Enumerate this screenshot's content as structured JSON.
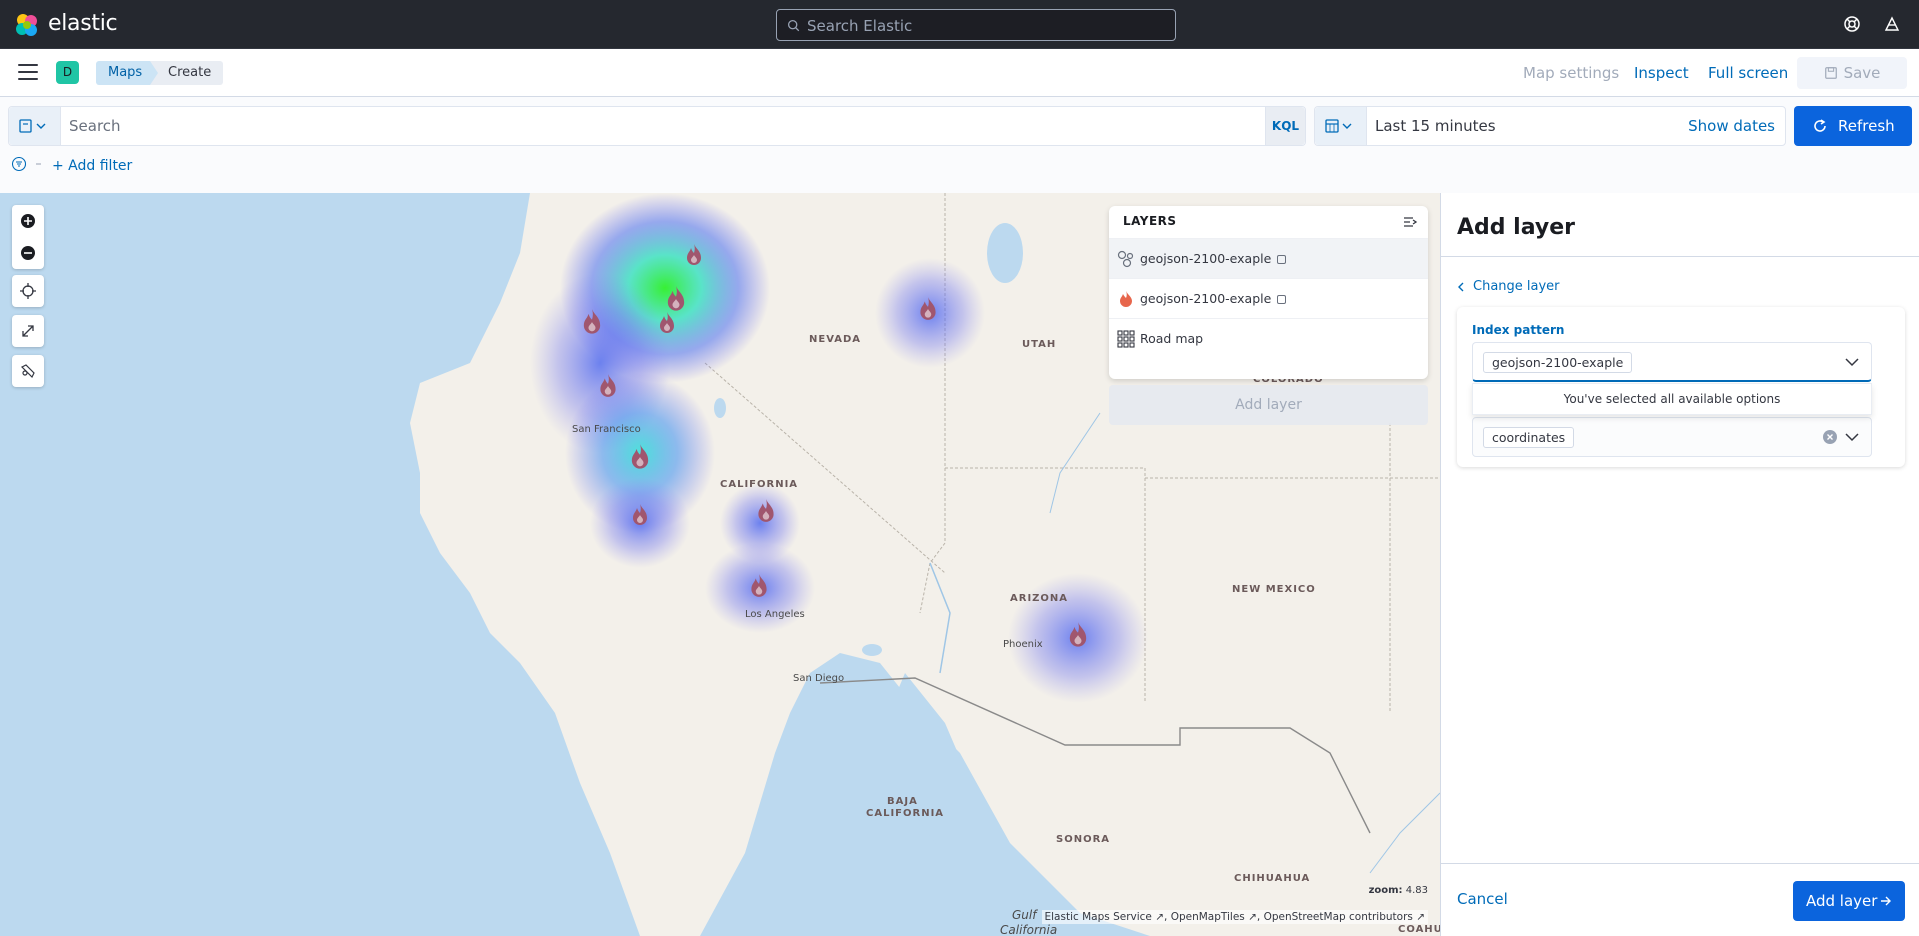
{
  "app": {
    "brand": "elastic",
    "space_initial": "D",
    "accent": "#0b64dd",
    "brand_teal": "#20c5a5"
  },
  "global_search": {
    "placeholder": "Search Elastic"
  },
  "breadcrumbs": [
    {
      "label": "Maps"
    },
    {
      "label": "Create"
    }
  ],
  "toolbar": {
    "map_settings": "Map settings",
    "inspect": "Inspect",
    "full_screen": "Full screen",
    "save": "Save"
  },
  "query": {
    "placeholder": "Search",
    "language": "KQL",
    "add_filter": "+ Add filter"
  },
  "time": {
    "range": "Last 15 minutes",
    "show_dates": "Show dates",
    "refresh": "Refresh"
  },
  "map": {
    "zoom_label": "zoom:",
    "zoom_value": "4.83",
    "attribution": [
      "Elastic Maps Service",
      "OpenMapTiles",
      "OpenStreetMap contributors"
    ],
    "labels": {
      "nevada": "NEVADA",
      "utah": "UTAH",
      "colorado": "COLORADO",
      "california": "CALIFORNIA",
      "arizona": "ARIZONA",
      "new_mexico": "NEW MEXICO",
      "baja": "BAJA",
      "baja2": "CALIFORNIA",
      "sonora": "SONORA",
      "chihuahua": "CHIHUAHUA",
      "coahu": "COAHU",
      "gulf": "Gulf",
      "gulf2": "California"
    },
    "cities": {
      "sf": "San Francisco",
      "la": "Los Angeles",
      "sd": "San Diego",
      "phoenix": "Phoenix"
    }
  },
  "layers_panel": {
    "title": "LAYERS",
    "items": [
      {
        "label": "geojson-2100-exaple",
        "icon": "cluster-icon"
      },
      {
        "label": "geojson-2100-exaple",
        "icon": "fire-icon"
      },
      {
        "label": "Road map",
        "icon": "grid-icon"
      }
    ],
    "add_layer": "Add layer"
  },
  "flyout": {
    "title": "Add layer",
    "change_layer": "Change layer",
    "index_pattern_label": "Index pattern",
    "index_pattern_value": "geojson-2100-exaple",
    "dropdown_message": "You've selected all available options",
    "geo_field_value": "coordinates",
    "cancel": "Cancel",
    "submit": "Add layer"
  }
}
